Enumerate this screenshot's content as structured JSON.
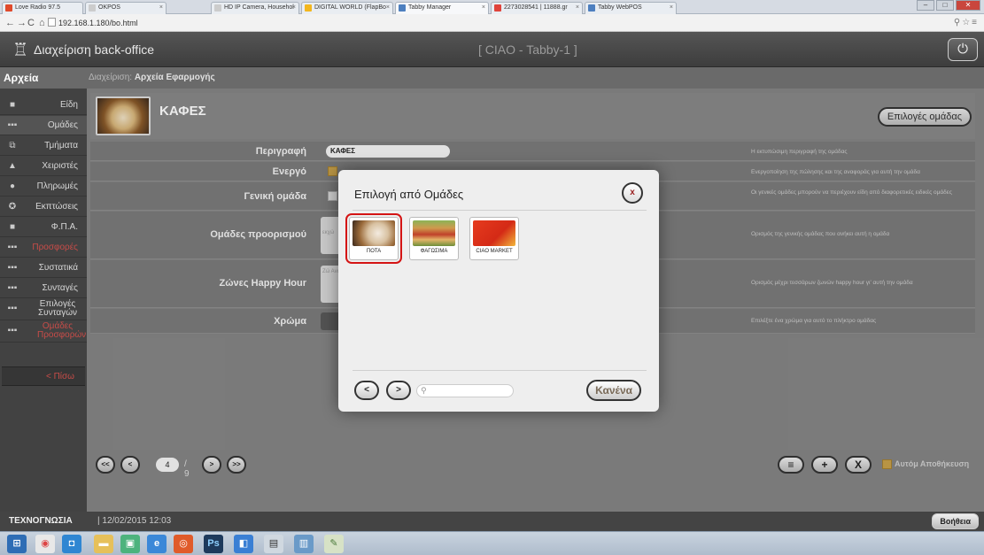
{
  "browser": {
    "tabs": [
      {
        "title": "Love Radio 97.5",
        "color": "#e04a2b",
        "active": false
      },
      {
        "title": "OKPOS",
        "color": "#cccccc",
        "active": false
      },
      {
        "title": "HD IP Camera, Househol",
        "color": "#cccccc",
        "active": false
      },
      {
        "title": "DIGITAL WORLD (FlapBo",
        "color": "#f3b61d",
        "active": false
      },
      {
        "title": "Tabby Manager",
        "color": "#4d7fbf",
        "active": true
      },
      {
        "title": "2273028541 | 11888.gr",
        "color": "#e0433b",
        "active": false
      },
      {
        "title": "Tabby WebPOS",
        "color": "#4d7fbf",
        "active": false
      }
    ],
    "url": "192.168.1.180/bo.html",
    "window_buttons": [
      "minimize",
      "maximize",
      "close"
    ]
  },
  "app": {
    "title": "Διαχείριση back-office",
    "center_title": "[ CIAO - Tabby-1 ]"
  },
  "section": {
    "label": "Αρχεία",
    "breadcrumb_prefix": "Διαχείριση:",
    "breadcrumb_page": "Αρχεία Εφαρμογής"
  },
  "sidebar": {
    "items": [
      {
        "label": "Είδη",
        "icon": "box-icon",
        "glyph": "■",
        "selected": false,
        "warn": false
      },
      {
        "label": "Ομάδες",
        "icon": "groups-icon",
        "glyph": "▪▪▪",
        "selected": true,
        "warn": false
      },
      {
        "label": "Τμήματα",
        "icon": "departments-icon",
        "glyph": "⧉",
        "selected": false,
        "warn": false
      },
      {
        "label": "Χειριστές",
        "icon": "user-icon",
        "glyph": "▲",
        "selected": false,
        "warn": false
      },
      {
        "label": "Πληρωμές",
        "icon": "payment-icon",
        "glyph": "●",
        "selected": false,
        "warn": false
      },
      {
        "label": "Εκπτώσεις",
        "icon": "discount-icon",
        "glyph": "✪",
        "selected": false,
        "warn": false
      },
      {
        "label": "Φ.Π.Α.",
        "icon": "vat-icon",
        "glyph": "■",
        "selected": false,
        "warn": false
      },
      {
        "label": "Προσφορές",
        "icon": "offers-icon",
        "glyph": "▪▪▪",
        "selected": false,
        "warn": true
      },
      {
        "label": "Συστατικά",
        "icon": "ingredients-icon",
        "glyph": "▪▪▪",
        "selected": false,
        "warn": false
      },
      {
        "label": "Συνταγές",
        "icon": "recipes-icon",
        "glyph": "▪▪▪",
        "selected": false,
        "warn": false
      },
      {
        "label": "Επιλογές Συνταγών",
        "icon": "recipe-options-icon",
        "glyph": "▪▪▪",
        "selected": false,
        "warn": false
      },
      {
        "label": "Ομάδες Προσφορών",
        "icon": "offer-groups-icon",
        "glyph": "▪▪▪",
        "selected": false,
        "warn": true
      }
    ],
    "back_label": "< Πίσω"
  },
  "group": {
    "name": "ΚΑΦΕΣ",
    "options_button": "Επιλογές ομάδας"
  },
  "form": {
    "description_label": "Περιγραφή",
    "description_value": "ΚΑΦΕΣ",
    "description_help": "Η εκτυπώσιμη περιγραφή της ομάδας",
    "active_label": "Ενεργό",
    "active_checked": true,
    "active_help": "Ενεργοποίηση της πώλησης και της αναφοράς για αυτή την ομάδα",
    "general_label": "Γενική ομάδα",
    "general_checked": false,
    "general_help": "Οι γενικές ομάδες μπορούν να περιέχουν είδη από διαφορετικές ειδικές ομάδες",
    "targets_label": "Ομάδες προορισμού",
    "targets_box_text": "εκχώ",
    "targets_help": "Ορισμός της γενικής ομάδας που ανήκει αυτή η ομάδα",
    "happy_label": "Ζώνες Happy Hour",
    "happy_box_text": "Ζώ Ανα",
    "happy_help": "Ορισμός μέχρι τεσσάρων ζωνών happy hour γι' αυτή την ομάδα",
    "color_label": "Χρώμα",
    "color_value": "#5a5a5a",
    "color_help": "Επιλέξτε ένα χρώμα για αυτό το πλήκτρο ομάδας"
  },
  "pager": {
    "first": "<<",
    "prev": "<",
    "current": "4",
    "total": "/ 9",
    "next": ">",
    "last": ">>"
  },
  "actions": {
    "list": "≡",
    "add": "+",
    "delete": "X",
    "autosave_label": "Αυτόμ Αποθήκευση",
    "autosave_checked": true
  },
  "status": {
    "org": "ΤΕΧΝΟΓΝΩΣΙΑ",
    "datetime": "| 12/02/2015 12:03",
    "help_button": "Βοήθεια"
  },
  "dialog": {
    "title": "Επιλογή από Ομάδες",
    "close": "x",
    "items": [
      {
        "label": "ΠΟΤΑ",
        "selected": true
      },
      {
        "label": "ΦΑΓΩΣΙΜΑ",
        "selected": false
      },
      {
        "label": "CIAO MARKET",
        "selected": false
      }
    ],
    "prev": "<",
    "next": ">",
    "search_placeholder": "",
    "none_button": "Κανένα"
  },
  "colors": {
    "accent_gold": "#c8a14a",
    "warn_red": "#d9534f",
    "selection_red": "#d41414"
  }
}
